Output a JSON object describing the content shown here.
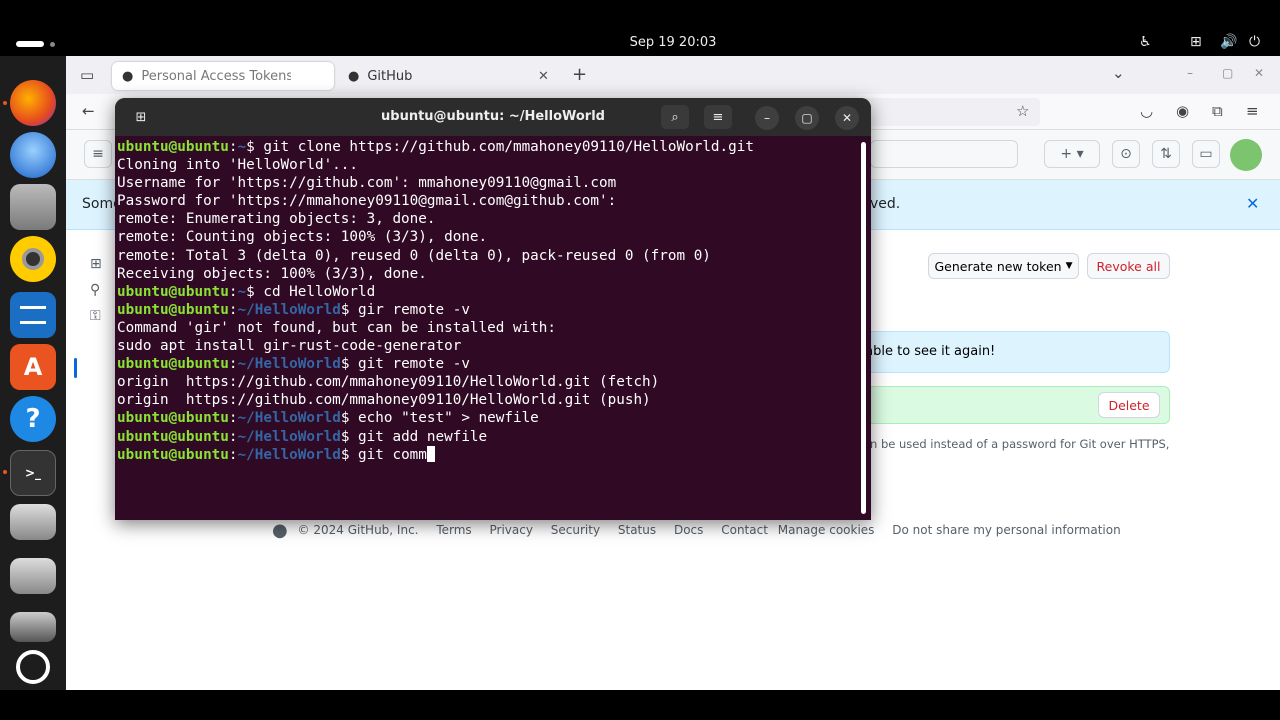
{
  "topbar": {
    "clock": "Sep 19  20:03"
  },
  "dock": {
    "items": [
      "firefox",
      "thunderbird",
      "files",
      "rhythmbox",
      "writer",
      "app-center",
      "help",
      "terminal",
      "drive",
      "drive",
      "drive",
      "ubuntu-logo"
    ]
  },
  "browser": {
    "tabs": [
      {
        "title": "Personal Access Tokens (",
        "active": true
      },
      {
        "title": "GitHub",
        "active": false
      }
    ]
  },
  "github": {
    "banner_start": "Some",
    "banner_end": "ved.",
    "generate_button": "Generate new token",
    "revoke_all_button": "Revoke all",
    "flash_text": "e able to see it again!",
    "delete_button": "Delete",
    "info_text": "n be used instead of a password for Git over HTTPS,",
    "footer": {
      "copyright": "© 2024 GitHub, Inc.",
      "links": [
        "Terms",
        "Privacy",
        "Security",
        "Status",
        "Docs",
        "Contact",
        "Manage cookies",
        "Do not share my personal information"
      ]
    }
  },
  "terminal": {
    "title": "ubuntu@ubuntu: ~/HelloWorld",
    "user": "ubuntu@ubuntu",
    "lines": [
      {
        "kind": "prompt",
        "path": "~",
        "cmd": "git clone https://github.com/mmahoney09110/HelloWorld.git"
      },
      {
        "kind": "out",
        "text": "Cloning into 'HelloWorld'..."
      },
      {
        "kind": "out",
        "text": "Username for 'https://github.com': mmahoney09110@gmail.com"
      },
      {
        "kind": "out",
        "text": "Password for 'https://mmahoney09110@gmail.com@github.com':"
      },
      {
        "kind": "out",
        "text": "remote: Enumerating objects: 3, done."
      },
      {
        "kind": "out",
        "text": "remote: Counting objects: 100% (3/3), done."
      },
      {
        "kind": "out",
        "text": "remote: Total 3 (delta 0), reused 0 (delta 0), pack-reused 0 (from 0)"
      },
      {
        "kind": "out",
        "text": "Receiving objects: 100% (3/3), done."
      },
      {
        "kind": "prompt",
        "path": "~",
        "cmd": "cd HelloWorld"
      },
      {
        "kind": "prompt",
        "path": "~/HelloWorld",
        "cmd": "gir remote -v"
      },
      {
        "kind": "out",
        "text": "Command 'gir' not found, but can be installed with:"
      },
      {
        "kind": "out",
        "text": "sudo apt install gir-rust-code-generator"
      },
      {
        "kind": "prompt",
        "path": "~/HelloWorld",
        "cmd": "git remote -v"
      },
      {
        "kind": "out",
        "text": "origin  https://github.com/mmahoney09110/HelloWorld.git (fetch)"
      },
      {
        "kind": "out",
        "text": "origin  https://github.com/mmahoney09110/HelloWorld.git (push)"
      },
      {
        "kind": "prompt",
        "path": "~/HelloWorld",
        "cmd": "echo \"test\" > newfile"
      },
      {
        "kind": "prompt",
        "path": "~/HelloWorld",
        "cmd": "git add newfile"
      },
      {
        "kind": "prompt",
        "path": "~/HelloWorld",
        "cmd": "git comm",
        "cursor": true
      }
    ]
  }
}
